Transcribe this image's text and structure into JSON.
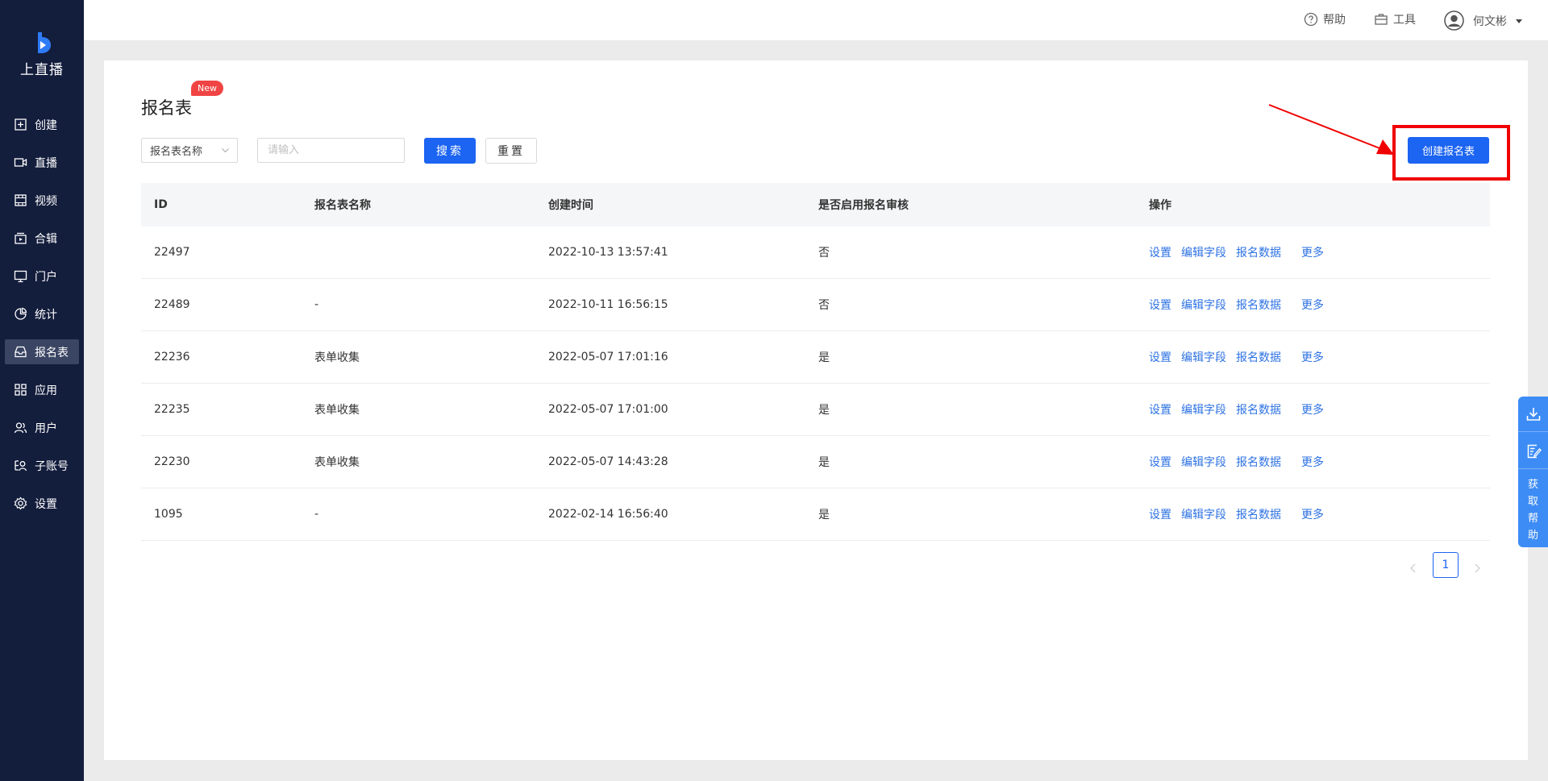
{
  "app": {
    "name": "上直播"
  },
  "sidebar": {
    "items": [
      {
        "label": "创建",
        "icon": "plus-square-icon"
      },
      {
        "label": "直播",
        "icon": "video-camera-icon"
      },
      {
        "label": "视频",
        "icon": "film-icon"
      },
      {
        "label": "合辑",
        "icon": "collection-icon"
      },
      {
        "label": "门户",
        "icon": "monitor-icon"
      },
      {
        "label": "统计",
        "icon": "pie-chart-icon"
      },
      {
        "label": "报名表",
        "icon": "inbox-icon",
        "active": true
      },
      {
        "label": "应用",
        "icon": "apps-icon"
      },
      {
        "label": "用户",
        "icon": "users-icon"
      },
      {
        "label": "子账号",
        "icon": "sub-account-icon"
      },
      {
        "label": "设置",
        "icon": "gear-icon"
      }
    ]
  },
  "header": {
    "help_label": "帮助",
    "tools_label": "工具",
    "user_name": "何文彬"
  },
  "page": {
    "title": "报名表",
    "new_badge": "New"
  },
  "filters": {
    "field_select": "报名表名称",
    "search_placeholder": "请输入",
    "search_button": "搜索",
    "reset_button": "重置",
    "create_button": "创建报名表"
  },
  "table": {
    "columns": [
      "ID",
      "报名表名称",
      "创建时间",
      "是否启用报名审核",
      "操作"
    ],
    "rows": [
      {
        "id": "22497",
        "name": "",
        "created": "2022-10-13 13:57:41",
        "review": "否"
      },
      {
        "id": "22489",
        "name": "-",
        "created": "2022-10-11 16:56:15",
        "review": "否"
      },
      {
        "id": "22236",
        "name": "表单收集",
        "created": "2022-05-07 17:01:16",
        "review": "是"
      },
      {
        "id": "22235",
        "name": "表单收集",
        "created": "2022-05-07 17:01:00",
        "review": "是"
      },
      {
        "id": "22230",
        "name": "表单收集",
        "created": "2022-05-07 14:43:28",
        "review": "是"
      },
      {
        "id": "1095",
        "name": "-",
        "created": "2022-02-14 16:56:40",
        "review": "是"
      }
    ],
    "actions": {
      "settings": "设置",
      "edit_fields": "编辑字段",
      "signup_data": "报名数据",
      "more": "更多"
    }
  },
  "pagination": {
    "current_page": "1"
  },
  "float_toolbar": {
    "help_text": "获取帮助"
  },
  "colors": {
    "primary": "#1c64f2",
    "sidebar": "#131d3c",
    "link": "#2d72e3",
    "highlight": "#f00000",
    "badge": "#f04444"
  }
}
